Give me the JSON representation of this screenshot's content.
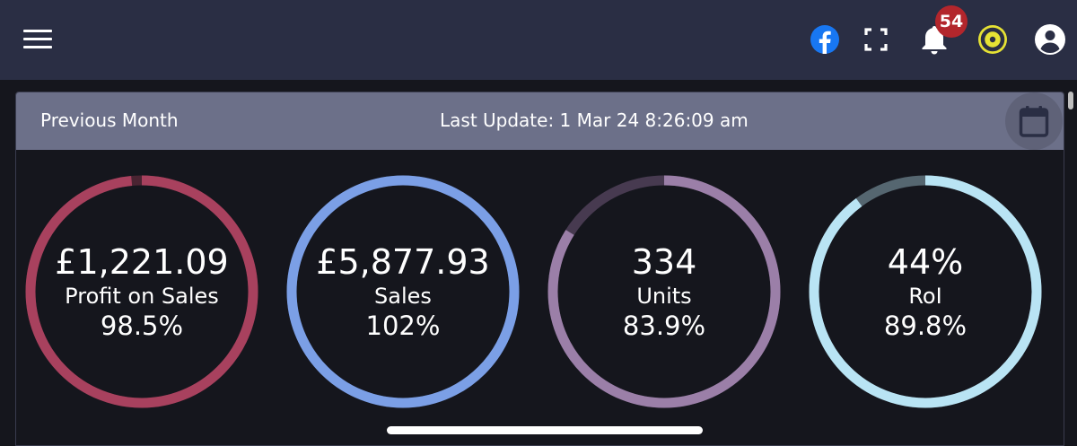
{
  "topbar": {
    "notification_count": "54",
    "icons": [
      "menu-icon",
      "facebook-icon",
      "fullscreen-icon",
      "bell-icon",
      "lifebuoy-icon",
      "account-icon"
    ]
  },
  "card": {
    "period": "Previous Month",
    "last_update": "Last Update: 1 Mar 24 8:26:09 am",
    "calendar_icon": "calendar-icon"
  },
  "gauges": [
    {
      "value": "£1,221.09",
      "label": "Profit on Sales",
      "pct": "98.5%",
      "fill": 0.985,
      "color": "#a8415e",
      "track": "#4a2432"
    },
    {
      "value": "£5,877.93",
      "label": "Sales",
      "pct": "102%",
      "fill": 1.0,
      "color": "#7b9fe6",
      "track": "#2f3d5e"
    },
    {
      "value": "334",
      "label": "Units",
      "pct": "83.9%",
      "fill": 0.839,
      "color": "#9b7fa8",
      "track": "#473a50"
    },
    {
      "value": "44%",
      "label": "RoI",
      "pct": "89.8%",
      "fill": 0.898,
      "color": "#b9e4f4",
      "track": "#556670"
    }
  ]
}
